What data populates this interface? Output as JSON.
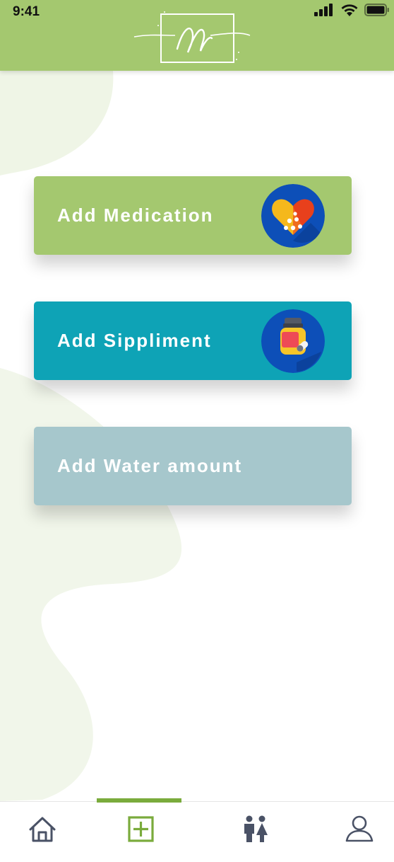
{
  "status_bar": {
    "time": "9:41"
  },
  "header": {
    "logo_icon": "script-monogram-logo"
  },
  "actions": [
    {
      "label": "Add Medication",
      "color": "#a4c86f",
      "icon": "pills-heart-icon"
    },
    {
      "label": "Add Sippliment",
      "color": "#0ea3b6",
      "icon": "supplement-jar-icon"
    },
    {
      "label": "Add Water amount",
      "color": "#a6c7cc",
      "icon": ""
    }
  ],
  "tabbar": {
    "active_index": 1,
    "active_color": "#7aab3c",
    "tabs": [
      {
        "icon": "home-icon"
      },
      {
        "icon": "add-square-icon"
      },
      {
        "icon": "people-icon"
      },
      {
        "icon": "profile-icon"
      }
    ]
  }
}
